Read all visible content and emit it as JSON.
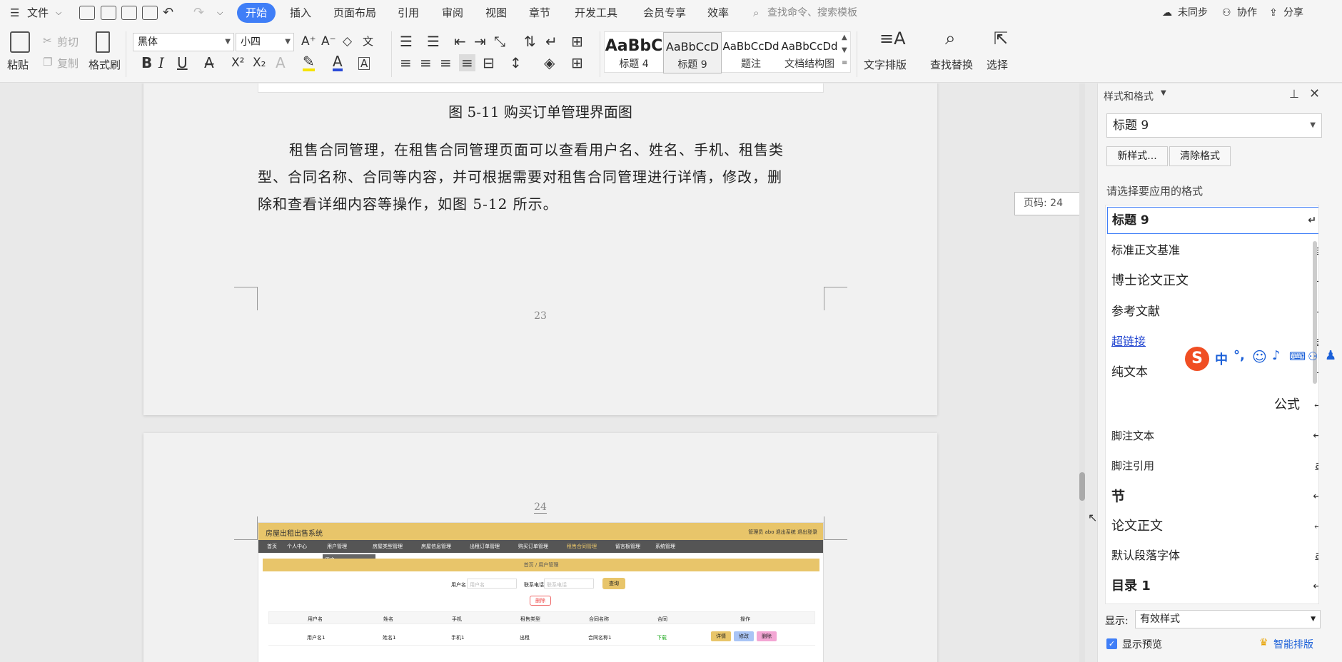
{
  "menubar": {
    "file": "文件",
    "tabs": [
      "开始",
      "插入",
      "页面布局",
      "引用",
      "审阅",
      "视图",
      "章节",
      "开发工具",
      "会员专享",
      "效率"
    ],
    "search_placeholder": "查找命令、搜索模板",
    "sync": "未同步",
    "collab": "协作",
    "share": "分享"
  },
  "ribbon": {
    "paste": "粘贴",
    "cut": "剪切",
    "copy": "复制",
    "format_painter": "格式刷",
    "font_name": "黑体",
    "font_size": "小四",
    "styles": [
      {
        "preview": "AaBbC",
        "label": "标题 4"
      },
      {
        "preview": "AaBbCcD",
        "label": "标题 9"
      },
      {
        "preview": "AaBbCcDd",
        "label": "题注"
      },
      {
        "preview": "AaBbCcDd",
        "label": "文档结构图"
      }
    ],
    "text_layout": "文字排版",
    "find_replace": "查找替换",
    "select": "选择"
  },
  "doc": {
    "caption": "图 5-11 购买订单管理界面图",
    "para_lines": [
      "租售合同管理，在租售合同管理页面可以查看用户名、姓名、手机、租售类",
      "型、合同名称、合同等内容，并可根据需要对租售合同管理进行详情，修改，删",
      "除和查看详细内容等操作，如图 5-12 所示。"
    ],
    "page_num_1": "23",
    "page_num_2": "24",
    "page_tooltip": "页码: 24"
  },
  "screenshot": {
    "title": "房屋出租出售系统",
    "top_right": "管理员 abo  退出系统  退出登录",
    "nav": [
      "首页",
      "个人中心",
      "用户管理",
      "房屋类型管理",
      "房屋信息管理",
      "出租订单管理",
      "购买订单管理",
      "租售合同管理",
      "留言板管理",
      "系统管理"
    ],
    "dropdown": "用户",
    "breadcrumb": "首页 / 用户管理",
    "search_label1": "用户名",
    "search_ph1": "用户名",
    "search_label2": "联系电话",
    "search_ph2": "联系电话",
    "search_btn": "查询",
    "delete_btn": "删除",
    "headers": [
      "用户名",
      "姓名",
      "手机",
      "租售类型",
      "合同名称",
      "合同",
      "操作"
    ],
    "row": [
      "用户名1",
      "姓名1",
      "手机1",
      "出租",
      "合同名称1",
      "下载"
    ],
    "actions": [
      "详情",
      "修改",
      "删除"
    ]
  },
  "panel": {
    "title": "样式和格式",
    "current_style": "标题 9",
    "new_style": "新样式...",
    "clear_format": "清除格式",
    "prompt": "请选择要应用的格式",
    "styles": [
      {
        "name": "标题 9",
        "mark": "↵"
      },
      {
        "name": "标准正文基准",
        "mark": "a"
      },
      {
        "name": "博士论文正文",
        "mark": "↵"
      },
      {
        "name": "参考文献",
        "mark": "↵"
      },
      {
        "name": "超链接",
        "mark": "a"
      },
      {
        "name": "纯文本",
        "mark": "↵"
      },
      {
        "name": "公式",
        "mark": "↵"
      },
      {
        "name": "脚注文本",
        "mark": "↵"
      },
      {
        "name": "脚注引用",
        "mark": "a"
      },
      {
        "name": "节",
        "mark": "↵"
      },
      {
        "name": "论文正文",
        "mark": "↵"
      },
      {
        "name": "默认段落字体",
        "mark": "a"
      },
      {
        "name": "目录 1",
        "mark": "↵"
      }
    ],
    "show_label": "显示:",
    "show_value": "有效样式",
    "preview_label": "显示预览",
    "smart_layout": "智能排版"
  },
  "ime": {
    "lang": "中",
    "punct": "°,"
  },
  "colors": {
    "accent": "#3f7ef7",
    "sys_header": "#e8c56a",
    "nav_bg": "#555555"
  }
}
